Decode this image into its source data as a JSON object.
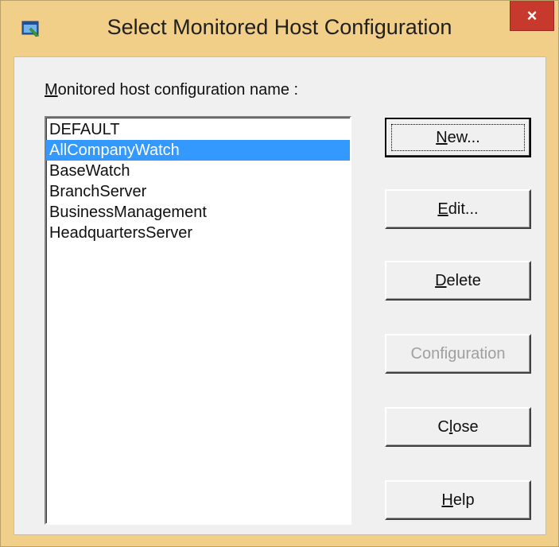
{
  "window": {
    "title": "Select Monitored Host Configuration",
    "close_label": "×"
  },
  "label": {
    "accel": "M",
    "rest": "onitored host configuration name :"
  },
  "list": {
    "items": [
      "DEFAULT",
      "AllCompanyWatch",
      "BaseWatch",
      "BranchServer",
      "BusinessManagement",
      "HeadquartersServer"
    ],
    "selected": "AllCompanyWatch"
  },
  "buttons": {
    "new": {
      "accel": "N",
      "rest": "ew..."
    },
    "edit": {
      "accel": "E",
      "rest": "dit..."
    },
    "delete": {
      "accel": "D",
      "rest": "elete"
    },
    "configuration": {
      "accel": "",
      "rest": "Configuration"
    },
    "close": {
      "pre": "C",
      "accel": "l",
      "rest": "ose"
    },
    "help": {
      "accel": "H",
      "rest": "elp"
    }
  },
  "colors": {
    "frame": "#f2cf88",
    "close": "#c7392c",
    "selection": "#3399ff"
  },
  "icons": {
    "app": "window-app-icon",
    "close": "close-icon"
  }
}
